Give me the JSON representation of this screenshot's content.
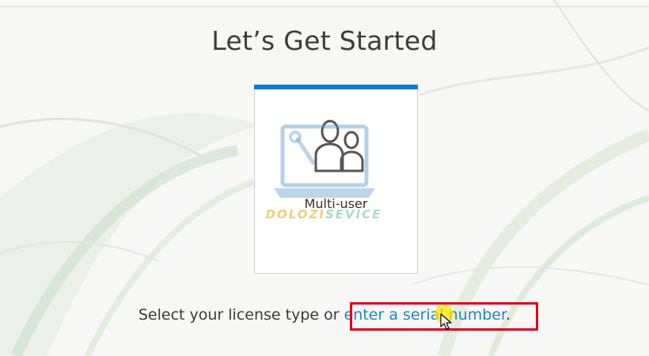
{
  "page": {
    "title": "Let’s Get Started"
  },
  "license_card": {
    "label": "Multi-user",
    "icon": "multi-user-icon",
    "accent_color": "#0a7bd4"
  },
  "prompt": {
    "text": "Select your license type or ",
    "link_text": "enter a serial number",
    "suffix": "."
  },
  "watermark": {
    "part1": "DOLOZI",
    "part2": "SEVICE"
  },
  "colors": {
    "link": "#1a86c8",
    "highlight": "#e0001b"
  }
}
